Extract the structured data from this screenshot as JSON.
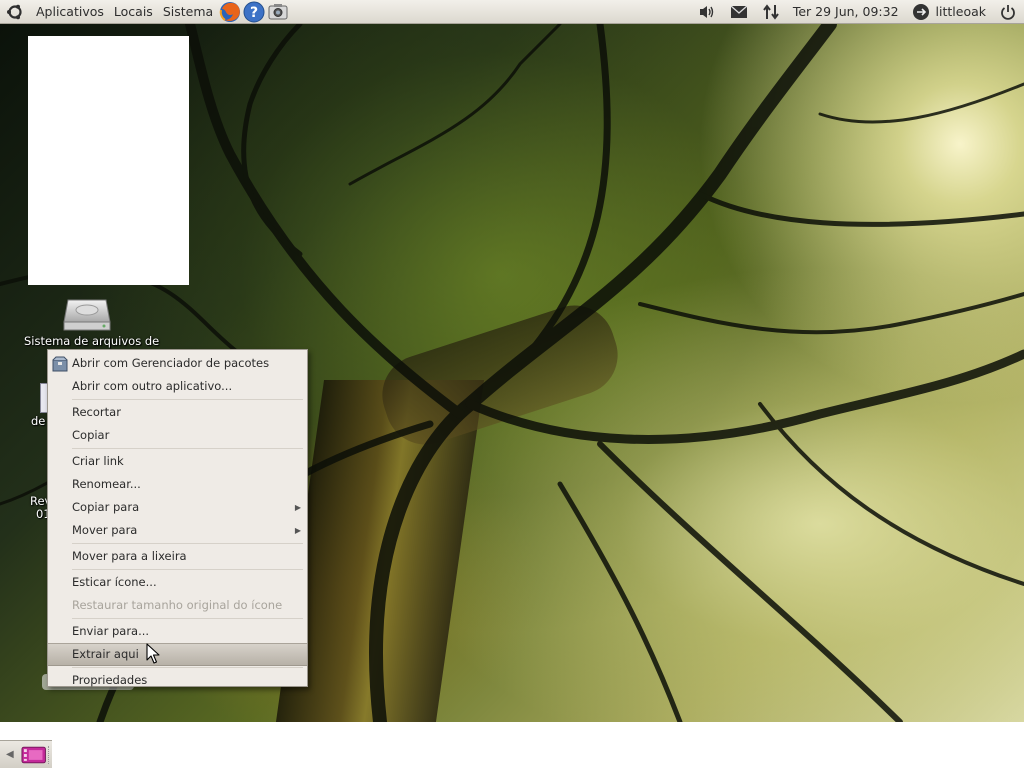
{
  "top_panel": {
    "menus": [
      "Aplicativos",
      "Locais",
      "Sistema"
    ],
    "launchers": [
      "firefox-icon",
      "help-icon",
      "screenshot-icon"
    ],
    "clock": "Ter 29 Jun, 09:32",
    "user": "littleoak"
  },
  "desktop": {
    "icons": [
      {
        "label": "Sistema de arquivos de",
        "icon": "harddisk-icon"
      },
      {
        "label": "de",
        "icon": "file-icon"
      },
      {
        "label": "Rev",
        "label2": "01",
        "icon": "document-icon"
      }
    ]
  },
  "context_menu": {
    "items": [
      {
        "label": "Abrir com Gerenciador de pacotes",
        "icon": "package-icon"
      },
      {
        "label": "Abrir com outro aplicativo..."
      },
      {
        "label": "Recortar"
      },
      {
        "label": "Copiar"
      },
      {
        "label": "Criar link"
      },
      {
        "label": "Renomear..."
      },
      {
        "label": "Copiar para",
        "submenu": true
      },
      {
        "label": "Mover para",
        "submenu": true
      },
      {
        "label": "Mover para a lixeira"
      },
      {
        "label": "Esticar ícone..."
      },
      {
        "label": "Restaurar tamanho original do ícone",
        "disabled": true
      },
      {
        "label": "Enviar para..."
      },
      {
        "label": "Extrair aqui",
        "hover": true
      },
      {
        "label": "Propriedades"
      }
    ]
  },
  "colors": {
    "panel_bg": "#dcd8cf",
    "menu_bg": "#efebe6",
    "hover_bg": "#b7b1a7",
    "ubuntu_orange": "#dd4814"
  }
}
